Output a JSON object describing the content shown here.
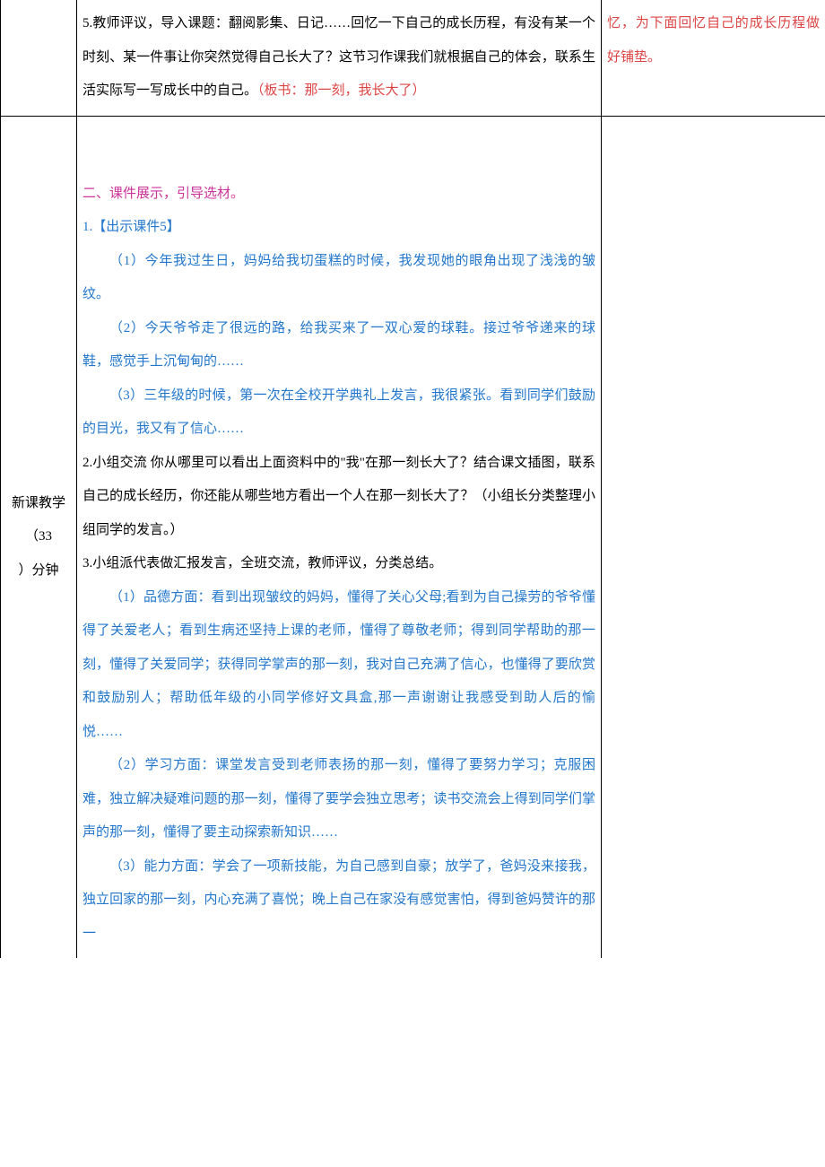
{
  "row1": {
    "mid": {
      "p1": "5.教师评议，导入课题：翻阅影集、日记……回忆一下自己的成长历程，有没有某一个时刻、某一件事让你突然觉得自己长大了？这节习作课我们就根据自己的体会，联系生活实际写一写成长中的自己。",
      "p1_red": "（板书：那一刻，我长大了）"
    },
    "right": {
      "p1": "忆，为下面回忆自己的成长历程做好铺垫。"
    }
  },
  "row2": {
    "left": {
      "l1": "新课教学",
      "l2": "（33",
      "l3": "）分钟"
    },
    "mid": {
      "h1": "二、课件展示，引导选材。",
      "p1": "1.【出示课件5】",
      "p2": "（1）今年我过生日，妈妈给我切蛋糕的时候，我发现她的眼角出现了浅浅的皱纹。",
      "p3": "（2）今天爷爷走了很远的路，给我买来了一双心爱的球鞋。接过爷爷递来的球鞋，感觉手上沉甸甸的……",
      "p4": "（3）三年级的时候，第一次在全校开学典礼上发言，我很紧张。看到同学们鼓励的目光，我又有了信心……",
      "p5": "2.小组交流 你从哪里可以看出上面资料中的\"我\"在那一刻长大了？结合课文插图，联系自己的成长经历，你还能从哪些地方看出一个人在那一刻长大了？（小组长分类整理小组同学的发言。）",
      "p6": "3.小组派代表做汇报发言，全班交流，教师评议，分类总结。",
      "p7": "（1）品德方面：看到出现皱纹的妈妈，懂得了关心父母;看到为自己操劳的爷爷懂得了关爱老人；看到生病还坚持上课的老师，懂得了尊敬老师；得到同学帮助的那一刻，懂得了关爱同学；获得同学掌声的那一刻，我对自己充满了信心，也懂得了要欣赏和鼓励别人；帮助低年级的小同学修好文具盒,那一声谢谢让我感受到助人后的愉悦……",
      "p8": "（2）学习方面：课堂发言受到老师表扬的那一刻，懂得了要努力学习；克服困难，独立解决疑难问题的那一刻，懂得了要学会独立思考；读书交流会上得到同学们掌声的那一刻，懂得了要主动探索新知识……",
      "p9": "（3）能力方面：学会了一项新技能，为自己感到自豪；放学了，爸妈没来接我，独立回家的那一刻，内心充满了喜悦；晚上自己在家没有感觉害怕，得到爸妈赞许的那一"
    }
  }
}
